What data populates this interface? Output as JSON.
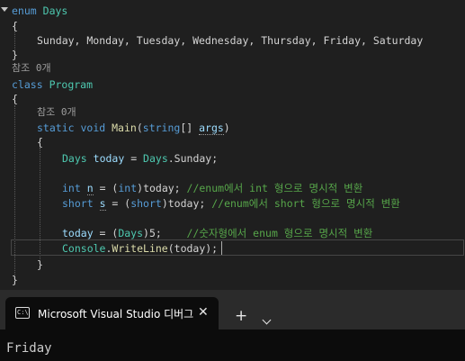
{
  "code": {
    "l1": {
      "kw": "enum",
      "name": "Days"
    },
    "l2": "{",
    "l3": "Sunday, Monday, Tuesday, Wednesday, Thursday, Friday, Saturday",
    "l4": "}",
    "ref1": "참조 0개",
    "l5": {
      "kw": "class",
      "name": "Program"
    },
    "l6": "{",
    "ref2": "참조 0개",
    "l7": {
      "static": "static",
      "void": "void",
      "main": "Main",
      "open": "(",
      "type": "string",
      "brackets": "[] ",
      "arg": "args",
      "close": ")"
    },
    "l8": "{",
    "l9": {
      "type": "Days",
      "var": "today",
      "rest": " = ",
      "type2": "Days",
      "rest2": ".Sunday;"
    },
    "l10": {
      "kw": "int",
      "var": "n",
      "rest1": " = (",
      "cast": "int",
      "rest2": ")today; ",
      "comment": "//enum에서 int 형으로 명시적 변환"
    },
    "l11": {
      "kw": "short",
      "var": "s",
      "rest1": " = (",
      "cast": "short",
      "rest2": ")today; ",
      "comment": "//enum에서 short 형으로 명시적 변환"
    },
    "l12": {
      "var": "today",
      "rest1": " = (",
      "type": "Days",
      "rest2": ")5;    ",
      "comment": "//숫자형에서 enum 형으로 명시적 변환"
    },
    "l13": {
      "type": "Console",
      "dot": ".",
      "method": "WriteLine",
      "rest": "(today);"
    },
    "l14": "}",
    "l15": "}"
  },
  "terminal": {
    "tab_title": "Microsoft Visual Studio 디버그",
    "tab_icon_text": "C:\\",
    "close_glyph": "✕",
    "new_tab_glyph": "+",
    "output": "Friday"
  }
}
